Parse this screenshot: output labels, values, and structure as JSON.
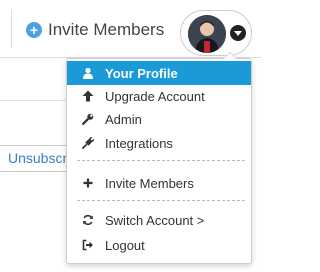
{
  "topbar": {
    "invite_label": "Invite Members"
  },
  "background": {
    "unsubscribe_label": "Unsubscribe"
  },
  "menu": {
    "items": [
      {
        "label": "Your Profile",
        "icon": "user-icon",
        "active": true
      },
      {
        "label": "Upgrade Account",
        "icon": "arrow-up-icon",
        "active": false
      },
      {
        "label": "Admin",
        "icon": "wrench-icon",
        "active": false
      },
      {
        "label": "Integrations",
        "icon": "plug-icon",
        "active": false
      },
      {
        "label": "Invite Members",
        "icon": "plus-icon",
        "active": false
      },
      {
        "label": "Switch Account >",
        "icon": "refresh-icon",
        "active": false
      },
      {
        "label": "Logout",
        "icon": "sign-out-icon",
        "active": false
      }
    ]
  },
  "colors": {
    "accent": "#1a9ad6",
    "invite_icon": "#4aa3df",
    "link": "#3a7fc1"
  }
}
